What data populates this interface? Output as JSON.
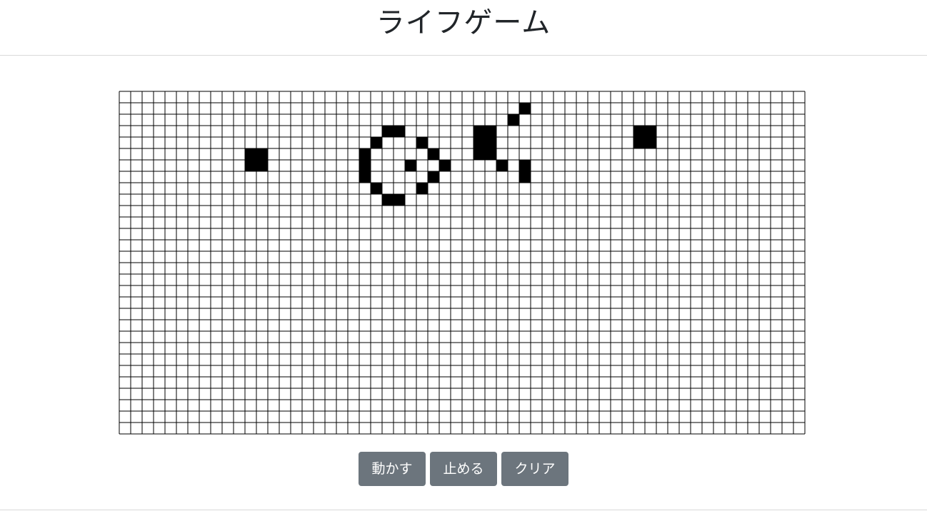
{
  "header": {
    "title": "ライフゲーム"
  },
  "board": {
    "columns": 60,
    "rows": 30,
    "live_color": "#000000",
    "dead_color": "#ffffff",
    "grid_color": "#000000",
    "live_cells": [
      [
        11,
        5
      ],
      [
        12,
        5
      ],
      [
        11,
        6
      ],
      [
        12,
        6
      ],
      [
        23,
        3
      ],
      [
        24,
        3
      ],
      [
        22,
        4
      ],
      [
        26,
        4
      ],
      [
        21,
        5
      ],
      [
        27,
        5
      ],
      [
        21,
        6
      ],
      [
        25,
        6
      ],
      [
        28,
        6
      ],
      [
        21,
        7
      ],
      [
        27,
        7
      ],
      [
        22,
        8
      ],
      [
        26,
        8
      ],
      [
        23,
        9
      ],
      [
        24,
        9
      ],
      [
        35,
        1
      ],
      [
        34,
        2
      ],
      [
        31,
        3
      ],
      [
        32,
        3
      ],
      [
        31,
        4
      ],
      [
        32,
        4
      ],
      [
        31,
        5
      ],
      [
        32,
        5
      ],
      [
        33,
        6
      ],
      [
        35,
        6
      ],
      [
        35,
        7
      ],
      [
        45,
        3
      ],
      [
        46,
        3
      ],
      [
        45,
        4
      ],
      [
        46,
        4
      ]
    ]
  },
  "controls": {
    "start_label": "動かす",
    "stop_label": "止める",
    "clear_label": "クリア"
  }
}
